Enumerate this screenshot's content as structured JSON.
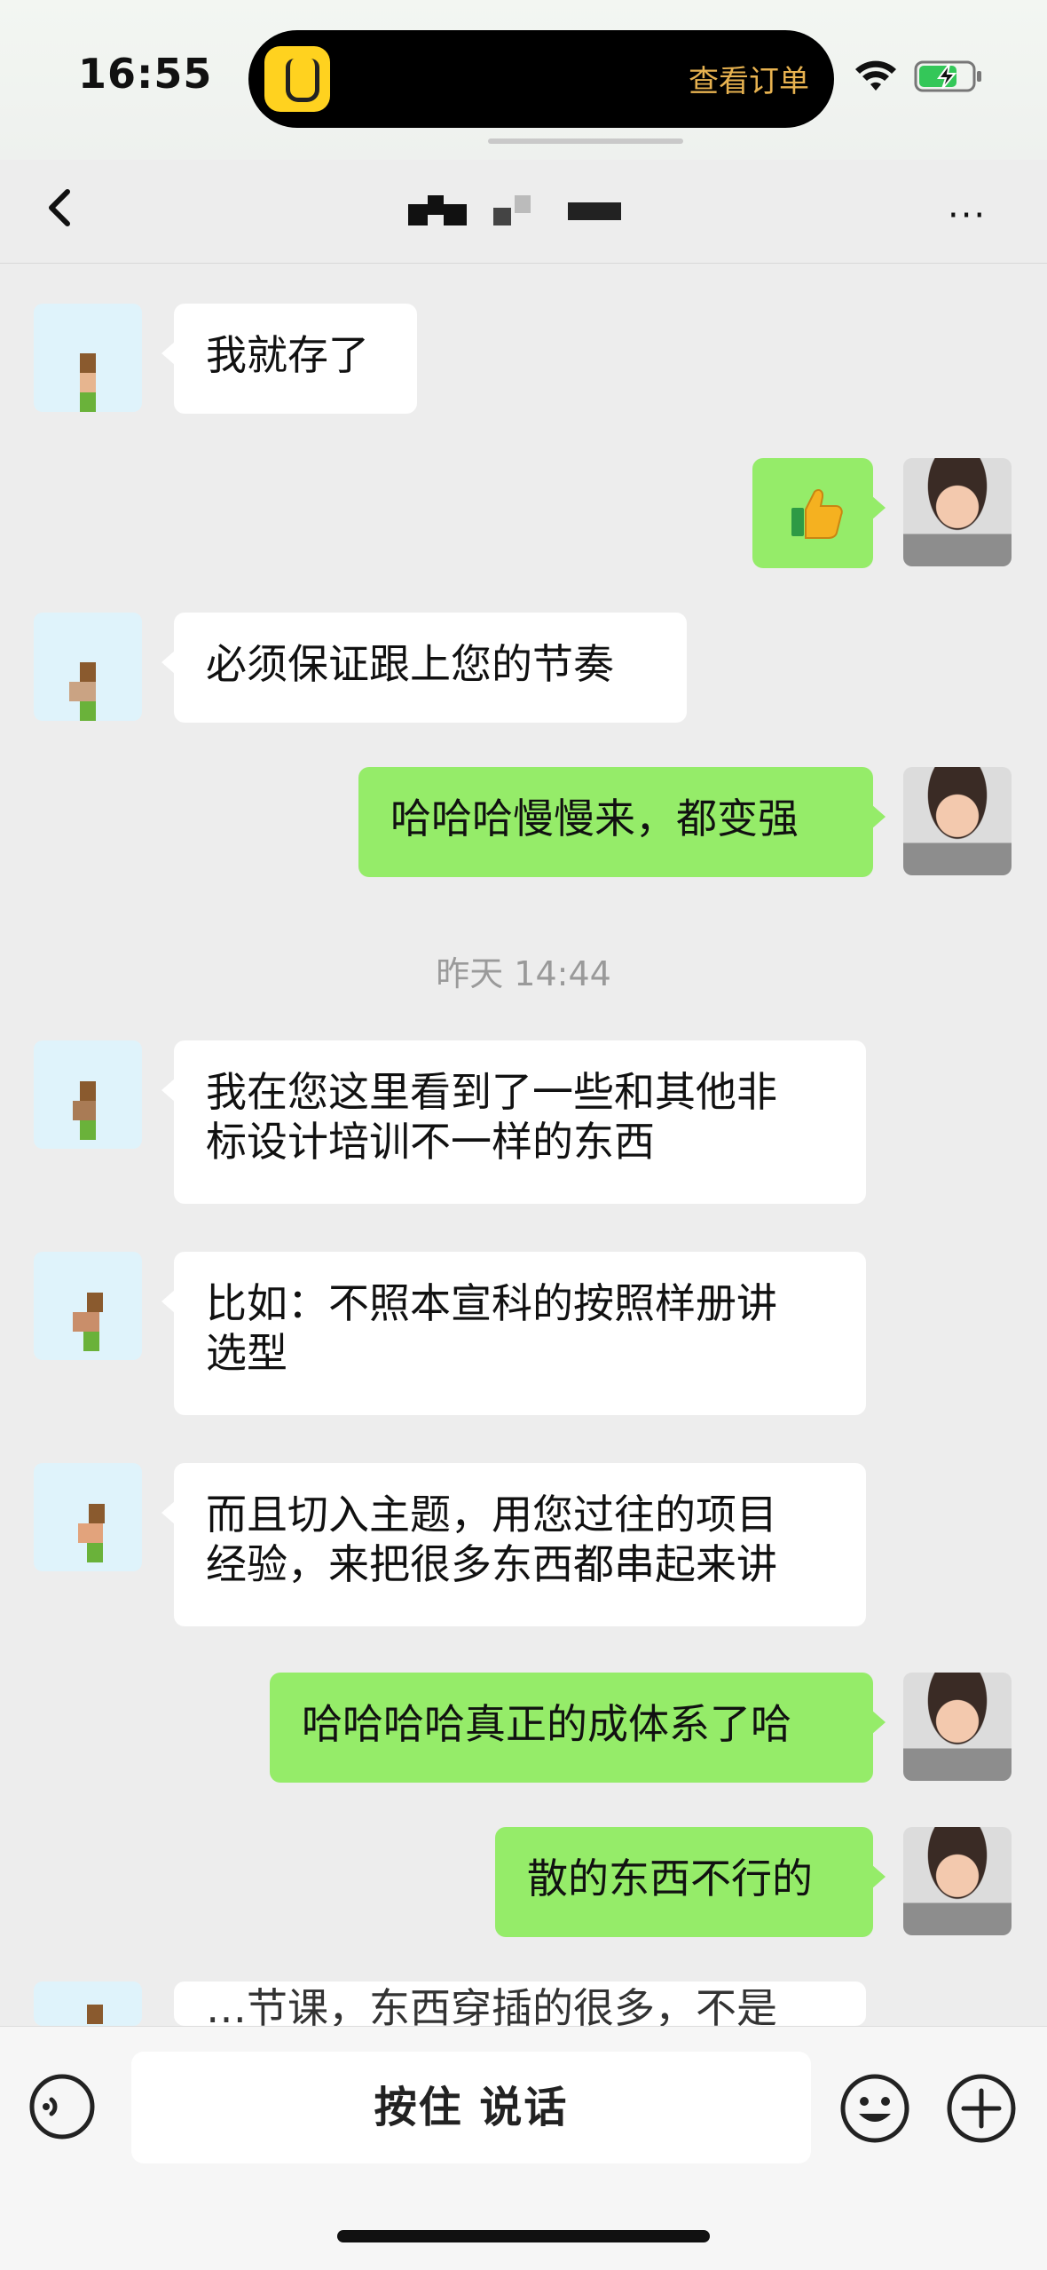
{
  "status_bar": {
    "time": "16:55",
    "island_text": "查看订单",
    "island_app_icon": "yellow-app-icon",
    "wifi_icon": "wifi-icon",
    "battery_icon": "battery-charging-icon"
  },
  "nav": {
    "back_icon": "back-arrow-icon",
    "title_icon": "pixelated-title",
    "more_icon": "more-icon",
    "more_glyph": "···"
  },
  "messages": [
    {
      "side": "left",
      "text": "我就存了"
    },
    {
      "side": "right",
      "text": "",
      "content": "thumbs-up-emoji"
    },
    {
      "side": "left",
      "text": "必须保证跟上您的节奏"
    },
    {
      "side": "right",
      "text": "哈哈哈慢慢来，都变强"
    },
    {
      "side": "left",
      "text": "我在您这里看到了一些和其他非\n标设计培训不一样的东西"
    },
    {
      "side": "left",
      "text": "比如：不照本宣科的按照样册讲\n选型"
    },
    {
      "side": "left",
      "text": "而且切入主题，用您过往的项目\n经验，来把很多东西都串起来讲"
    },
    {
      "side": "right",
      "text": "哈哈哈哈真正的成体系了哈"
    },
    {
      "side": "right",
      "text": "散的东西不行的"
    },
    {
      "side": "left",
      "text": "…节课，东西穿插的很多，不是"
    }
  ],
  "timestamp": "昨天 14:44",
  "input_bar": {
    "hold_to_talk": "按住 说话",
    "voice_icon": "voice-input-icon",
    "emoji_icon": "emoji-icon",
    "plus_icon": "plus-icon"
  },
  "colors": {
    "background": "#ededed",
    "bubble_self": "#95ec69",
    "bubble_other": "#ffffff",
    "island_text": "#e7b250"
  }
}
